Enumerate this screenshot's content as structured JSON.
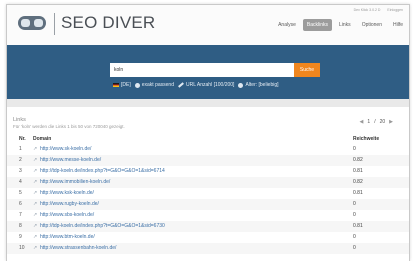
{
  "header": {
    "brand": "SEO DIVER",
    "toplinks": [
      "Dev Klick 3.0.2 D",
      "Einloggen"
    ],
    "nav": [
      {
        "label": "Analyse",
        "active": false
      },
      {
        "label": "Backlinks",
        "active": true
      },
      {
        "label": "Links",
        "active": false
      },
      {
        "label": "Optionen",
        "active": false
      },
      {
        "label": "Hilfe",
        "active": false
      }
    ]
  },
  "search": {
    "value": "koln",
    "button": "Suche",
    "options": [
      {
        "icon": "flag-de-icon",
        "label": "[DE]"
      },
      {
        "icon": "radio-icon",
        "label": "exakt passend"
      },
      {
        "icon": "pencil-icon",
        "label": "URL Anzahl [100/200]"
      },
      {
        "icon": "radio-icon",
        "label": "Alter: [beliebig]"
      }
    ]
  },
  "results": {
    "title": "Links",
    "subtitle": "Für 'koln' werden die Links 1 bis 50 von 720040 gezeigt.",
    "pager": {
      "current": "1",
      "total": "20",
      "separator": "/"
    },
    "columns": {
      "nr": "Nr.",
      "domain": "Domain",
      "reach": "Reichweite"
    },
    "rows": [
      {
        "nr": "1",
        "domain": "http://www.sk-koeln.de/",
        "reach": "0"
      },
      {
        "nr": "2",
        "domain": "http://www.messe-koeln.de/",
        "reach": "0.82"
      },
      {
        "nr": "3",
        "domain": "http://tdp-koeln.de/index.php?t=G&O=G&O=1&sid=6714",
        "reach": "0.81"
      },
      {
        "nr": "4",
        "domain": "http://www.immobilien-koeln.de/",
        "reach": "0.82"
      },
      {
        "nr": "5",
        "domain": "http://www.ksk-koeln.de/",
        "reach": "0.81"
      },
      {
        "nr": "6",
        "domain": "http://www.rugby-koeln.de/",
        "reach": "0"
      },
      {
        "nr": "7",
        "domain": "http://www.sbs-koeln.de/",
        "reach": "0"
      },
      {
        "nr": "8",
        "domain": "http://tdp-koeln.de/index.php?t=G&O=G&O=1&sid=6730",
        "reach": "0.81"
      },
      {
        "nr": "9",
        "domain": "http://www.btm-koeln.de/",
        "reach": "0"
      },
      {
        "nr": "10",
        "domain": "http://www.strassenbahn-koeln.de/",
        "reach": "0"
      }
    ]
  },
  "colors": {
    "search_band": "#2f5d84",
    "accent_button": "#f0861e",
    "link": "#3b6fa6"
  }
}
